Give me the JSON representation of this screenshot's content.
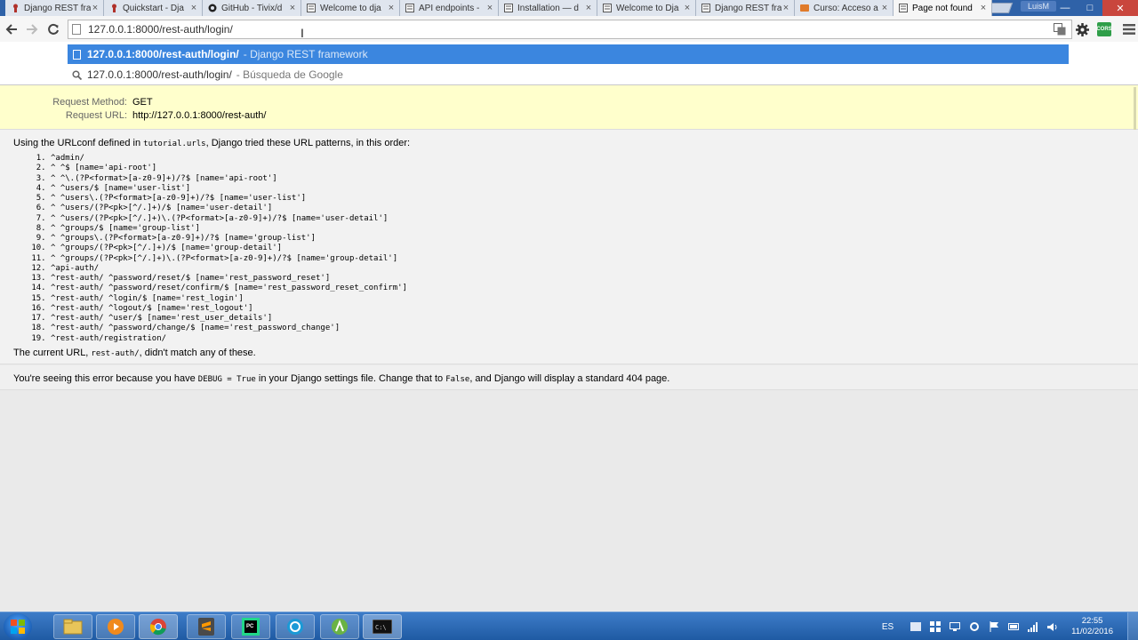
{
  "browser": {
    "tabs": [
      {
        "title": "Django REST fra",
        "favicon": "django-icon",
        "active": false
      },
      {
        "title": "Quickstart - Dja",
        "favicon": "django-icon",
        "active": false
      },
      {
        "title": "GitHub - Tivix/d",
        "favicon": "github-icon",
        "active": false
      },
      {
        "title": "Welcome to dja",
        "favicon": "doc-icon",
        "active": false
      },
      {
        "title": "API endpoints -",
        "favicon": "doc-icon",
        "active": false
      },
      {
        "title": "Installation — d",
        "favicon": "doc-icon",
        "active": false
      },
      {
        "title": "Welcome to Dja",
        "favicon": "doc-icon",
        "active": false
      },
      {
        "title": "Django REST fra",
        "favicon": "doc-icon",
        "active": false
      },
      {
        "title": "Curso: Acceso a",
        "favicon": "course-icon",
        "active": false
      },
      {
        "title": "Page not found",
        "favicon": "doc-icon",
        "active": true
      }
    ],
    "user_label": "LuisM",
    "window_controls": {
      "minimize": "—",
      "maximize": "□",
      "close": "✕"
    },
    "omnibox": {
      "value": "127.0.0.1:8000/rest-auth/login/"
    },
    "toolbar_icons": [
      "translate-icon",
      "settings-icon",
      "cors-extension-icon",
      "menu-icon"
    ],
    "cors_label": "CORS",
    "suggestions": [
      {
        "main": "127.0.0.1:8000/rest-auth/login/",
        "sub": "- Django REST framework",
        "icon": "page-icon",
        "selected": true
      },
      {
        "main": "127.0.0.1:8000/rest-auth/login/",
        "sub": "- Búsqueda de Google",
        "icon": "search-icon",
        "selected": false
      }
    ]
  },
  "page": {
    "request_method_label": "Request Method:",
    "request_method": "GET",
    "request_url_label": "Request URL:",
    "request_url": "http://127.0.0.1:8000/rest-auth/",
    "intro_prefix": "Using the URLconf defined in ",
    "intro_code": "tutorial.urls",
    "intro_suffix": ", Django tried these URL patterns, in this order:",
    "patterns": [
      "^admin/",
      "^ ^$ [name='api-root']",
      "^ ^\\.(?P<format>[a-z0-9]+)/?$ [name='api-root']",
      "^ ^users/$ [name='user-list']",
      "^ ^users\\.(?P<format>[a-z0-9]+)/?$ [name='user-list']",
      "^ ^users/(?P<pk>[^/.]+)/$ [name='user-detail']",
      "^ ^users/(?P<pk>[^/.]+)\\.(?P<format>[a-z0-9]+)/?$ [name='user-detail']",
      "^ ^groups/$ [name='group-list']",
      "^ ^groups\\.(?P<format>[a-z0-9]+)/?$ [name='group-list']",
      "^ ^groups/(?P<pk>[^/.]+)/$ [name='group-detail']",
      "^ ^groups/(?P<pk>[^/.]+)\\.(?P<format>[a-z0-9]+)/?$ [name='group-detail']",
      "^api-auth/",
      "^rest-auth/ ^password/reset/$ [name='rest_password_reset']",
      "^rest-auth/ ^password/reset/confirm/$ [name='rest_password_reset_confirm']",
      "^rest-auth/ ^login/$ [name='rest_login']",
      "^rest-auth/ ^logout/$ [name='rest_logout']",
      "^rest-auth/ ^user/$ [name='rest_user_details']",
      "^rest-auth/ ^password/change/$ [name='rest_password_change']",
      "^rest-auth/registration/"
    ],
    "current_prefix": "The current URL, ",
    "current_code": "rest-auth/",
    "current_suffix": ", didn't match any of these.",
    "debug_prefix": "You're seeing this error because you have ",
    "debug_code": "DEBUG = True",
    "debug_middle": " in your Django settings file. Change that to ",
    "debug_code2": "False",
    "debug_suffix": ", and Django will display a standard 404 page."
  },
  "taskbar": {
    "apps": [
      "explorer-icon",
      "media-player-icon",
      "chrome-icon",
      "sublime-text-icon",
      "pycharm-icon",
      "network-app-icon",
      "android-studio-icon",
      "terminal-icon"
    ],
    "language": "ES",
    "time": "22:55",
    "date": "11/02/2016"
  },
  "colors": {
    "summary_bg": "#ffffcc",
    "selection_blue": "#3b86df",
    "taskbar_blue": "#2a6ab8"
  }
}
